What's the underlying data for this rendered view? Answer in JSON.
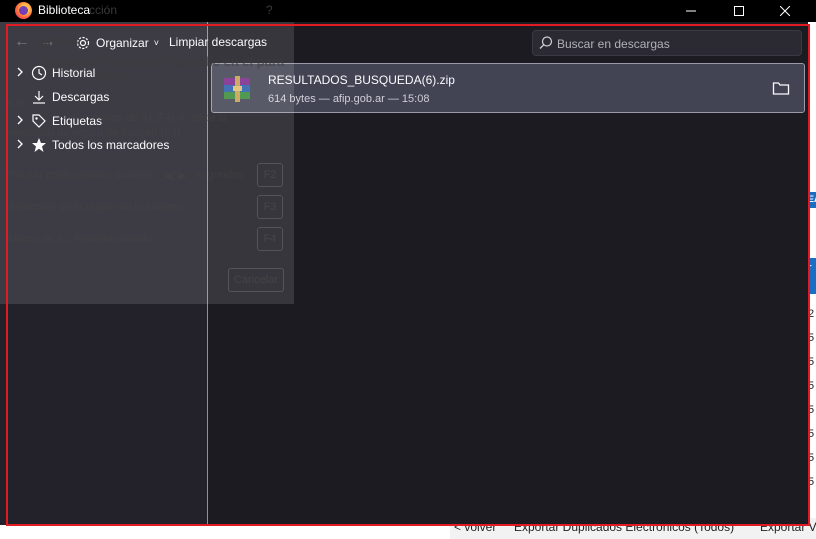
{
  "titlebar": {
    "title": "Biblioteca",
    "ghost_text": "cción",
    "help_glyph": "?"
  },
  "toolbar": {
    "back_glyph": "←",
    "forward_glyph": "→",
    "organize_label": "Organizar",
    "organize_caret": "˅",
    "clear_label": "Limpiar descargas",
    "search_placeholder": "Buscar en descargas"
  },
  "sidebar": {
    "items": [
      {
        "label": "Historial",
        "icon": "clock-icon",
        "expandable": true
      },
      {
        "label": "Descargas",
        "icon": "download-icon",
        "expandable": false
      },
      {
        "label": "Etiquetas",
        "icon": "tag-icon",
        "expandable": true
      },
      {
        "label": "Todos los marcadores",
        "icon": "star-icon",
        "expandable": true
      }
    ]
  },
  "download": {
    "filename": "RESULTADOS_BUSQUEDA(6).zip",
    "meta": "614 bytes — afip.gob.ar — 15:08",
    "icon": "winrar-archive-icon",
    "action_icon": "folder-icon"
  },
  "ghost_dialog": {
    "heading_line1": "Monte",
    "heading_line2": "que desea indicar y haga clic en el para",
    "heading_line3": "lario.",
    "line1": "a el",
    "line2": "marco de IU (F4) o utilice la",
    "line3": "selección de región de imagen (F3).",
    "pause_label": "Pausar configuración durante",
    "pause_value": "5",
    "pause_unit": "segundos",
    "key1": "F2",
    "region_label": "Selección de la región de la imagen",
    "key2": "F3",
    "frame_label": "Marco de IU: Predeterminado",
    "key3": "F4",
    "cancel_label": "Cancelar"
  },
  "background": {
    "right_numbers": [
      "2",
      "5",
      "5",
      "5",
      "5",
      "5",
      "5",
      "5"
    ],
    "right_tag_top": "EA",
    "right_tag_mid": "r",
    "bottom_back": "< volver",
    "bottom_export1": "Exportar Duplicados Electrónicos (Todos)",
    "bottom_export2": "Exportar Ve"
  },
  "colors": {
    "highlight": "#e01b24",
    "accent_bg": "#1c1b22",
    "row_bg": "#424453"
  }
}
